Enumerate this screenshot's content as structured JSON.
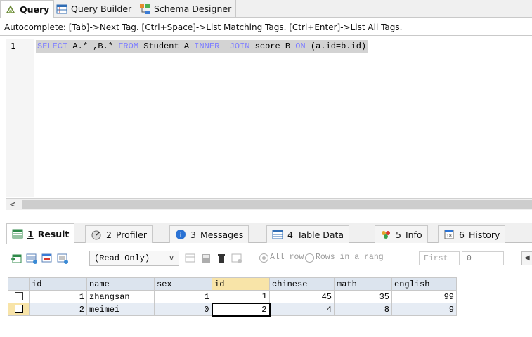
{
  "top_tabs": [
    {
      "label": "Query",
      "icon": "query-icon",
      "active": true
    },
    {
      "label": "Query Builder",
      "icon": "query-builder-icon",
      "active": false
    },
    {
      "label": "Schema Designer",
      "icon": "schema-designer-icon",
      "active": false
    }
  ],
  "autocomplete_hint": "Autocomplete: [Tab]->Next Tag. [Ctrl+Space]->List Matching Tags. [Ctrl+Enter]->List All Tags.",
  "editor": {
    "line_number": "1",
    "tokens": [
      "SELECT",
      " A.* ,B.* ",
      "FROM",
      " Student A ",
      "INNER  JOIN",
      " score B ",
      "ON",
      " (a.id=b.id)"
    ]
  },
  "result_tabs": [
    {
      "num": "1",
      "label": "Result",
      "icon": "result-icon",
      "active": true
    },
    {
      "num": "2",
      "label": "Profiler",
      "icon": "profiler-icon",
      "active": false
    },
    {
      "num": "3",
      "label": "Messages",
      "icon": "messages-icon",
      "active": false
    },
    {
      "num": "4",
      "label": "Table Data",
      "icon": "table-data-icon",
      "active": false
    },
    {
      "num": "5",
      "label": "Info",
      "icon": "info-icon",
      "active": false
    },
    {
      "num": "6",
      "label": "History",
      "icon": "history-icon",
      "active": false
    }
  ],
  "toolbar": {
    "mode": "(Read Only)",
    "all_rows_label": "All row",
    "rows_range_label": "Rows in a rang",
    "first_label": "First",
    "first_value": "0",
    "prev_glyph": "◀"
  },
  "grid": {
    "columns": [
      "id",
      "name",
      "sex",
      "id",
      "chinese",
      "math",
      "english"
    ],
    "rows": [
      [
        "1",
        "zhangsan",
        "1",
        "1",
        "45",
        "35",
        "99"
      ],
      [
        "2",
        "meimei",
        "0",
        "2",
        "4",
        "8",
        "9"
      ]
    ]
  }
}
